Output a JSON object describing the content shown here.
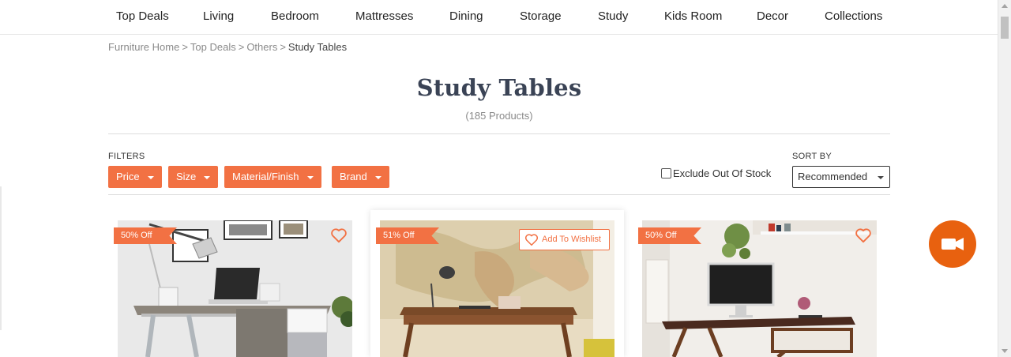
{
  "nav": {
    "items": [
      "Top Deals",
      "Living",
      "Bedroom",
      "Mattresses",
      "Dining",
      "Storage",
      "Study",
      "Kids Room",
      "Decor",
      "Collections"
    ]
  },
  "breadcrumb": {
    "items": [
      "Furniture Home",
      "Top Deals",
      "Others"
    ],
    "current": "Study Tables",
    "separator": ">"
  },
  "page": {
    "title": "Study Tables",
    "count": "(185 Products)"
  },
  "filters": {
    "label": "FILTERS",
    "buttons": [
      "Price",
      "Size",
      "Material/Finish",
      "Brand"
    ],
    "exclude_label": "Exclude Out Of Stock",
    "exclude_checked": false
  },
  "sort": {
    "label": "SORT BY",
    "selected": "Recommended"
  },
  "products": [
    {
      "discount": "50% Off",
      "wishlisted": false
    },
    {
      "discount": "51% Off",
      "wishlist_label": "Add To Wishlist"
    },
    {
      "discount": "50% Off",
      "wishlisted": false
    }
  ],
  "icons": {
    "wishlist": "heart-outline-icon",
    "video": "video-camera-icon",
    "caret": "caret-down-icon"
  },
  "colors": {
    "accent": "#f27143",
    "video_button": "#e8610f",
    "title": "#3a4355"
  }
}
